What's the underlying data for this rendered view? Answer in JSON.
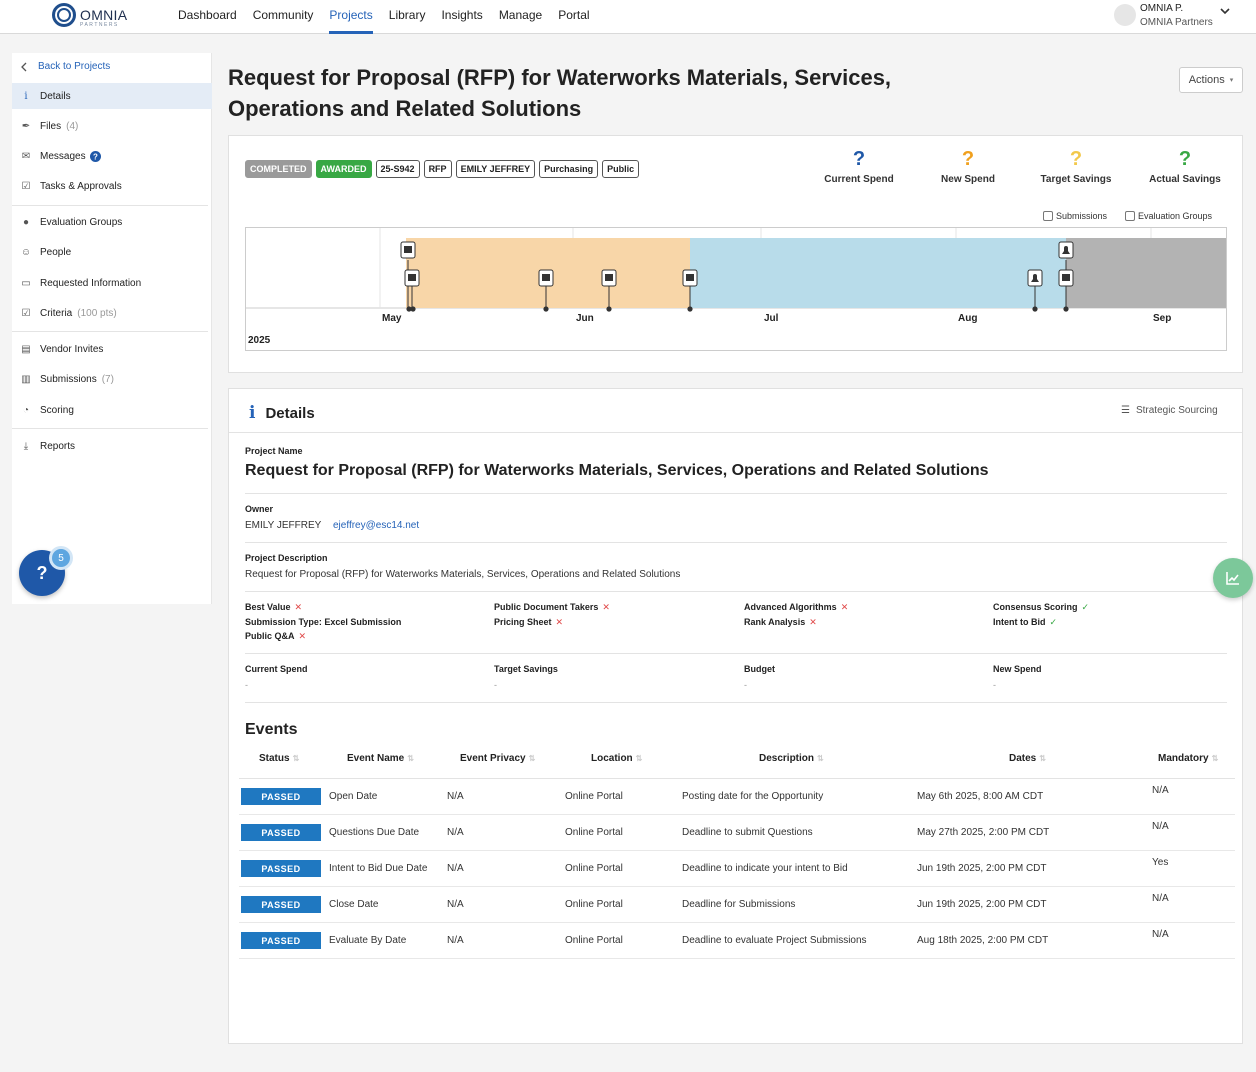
{
  "brand": {
    "name": "OMNIA",
    "sub": "PARTNERS"
  },
  "nav": [
    "Dashboard",
    "Community",
    "Projects",
    "Library",
    "Insights",
    "Manage",
    "Portal"
  ],
  "user": {
    "name": "OMNIA P.",
    "org": "OMNIA Partners"
  },
  "sidebar": {
    "back": "Back to Projects",
    "items": [
      {
        "label": "Details",
        "count": ""
      },
      {
        "label": "Files",
        "count": "(4)"
      },
      {
        "label": "Messages",
        "count": ""
      },
      {
        "label": "Tasks & Approvals",
        "count": ""
      },
      {
        "label": "Evaluation Groups",
        "count": ""
      },
      {
        "label": "People",
        "count": ""
      },
      {
        "label": "Requested Information",
        "count": ""
      },
      {
        "label": "Criteria",
        "count": "(100 pts)"
      },
      {
        "label": "Vendor Invites",
        "count": ""
      },
      {
        "label": "Submissions",
        "count": "(7)"
      },
      {
        "label": "Scoring",
        "count": ""
      },
      {
        "label": "Reports",
        "count": ""
      }
    ],
    "help_badge": "5",
    "help_glyph": "?"
  },
  "page": {
    "title": "Request for Proposal (RFP) for Waterworks Materials, Services, Operations and Related Solutions",
    "actions": "Actions"
  },
  "summary": {
    "tags": [
      "COMPLETED",
      "AWARDED",
      "25-S942",
      "RFP",
      "EMILY JEFFREY",
      "Purchasing",
      "Public"
    ],
    "kpis": [
      {
        "label": "Current Spend",
        "value": "?",
        "color": "#1f58a8"
      },
      {
        "label": "New Spend",
        "value": "?",
        "color": "#f0a01e"
      },
      {
        "label": "Target Savings",
        "value": "?",
        "color": "#f2c84a"
      },
      {
        "label": "Actual Savings",
        "value": "?",
        "color": "#38a844"
      }
    ],
    "checkboxes": [
      "Submissions",
      "Evaluation Groups"
    ]
  },
  "timeline": {
    "months": [
      "May",
      "Jun",
      "Jul",
      "Aug",
      "Sep"
    ],
    "year": "2025",
    "phase_colors": {
      "open": "#f8d6a8",
      "evaluation": "#b8dcea",
      "closed": "#b3b3b3"
    }
  },
  "details": {
    "heading": "Details",
    "strategic": "Strategic Sourcing",
    "project_name_label": "Project Name",
    "project_name": "Request for Proposal (RFP) for Waterworks Materials, Services, Operations and Related Solutions",
    "owner_label": "Owner",
    "owner_name": "EMILY JEFFREY",
    "owner_email": "ejeffrey@esc14.net",
    "desc_label": "Project Description",
    "desc": "Request for Proposal (RFP) for Waterworks Materials, Services, Operations and Related Solutions",
    "flags": [
      {
        "label": "Best Value",
        "on": false
      },
      {
        "label": "Submission Type: Excel Submission",
        "on": null
      },
      {
        "label": "Public Q&A",
        "on": false
      },
      {
        "label": "Public Document Takers",
        "on": false
      },
      {
        "label": "Pricing Sheet",
        "on": false
      },
      {
        "label": "Advanced Algorithms",
        "on": false
      },
      {
        "label": "Rank Analysis",
        "on": false
      },
      {
        "label": "Consensus Scoring",
        "on": true
      },
      {
        "label": "Intent to Bid",
        "on": true
      }
    ],
    "spend": [
      {
        "label": "Current Spend",
        "value": "-"
      },
      {
        "label": "Target Savings",
        "value": "-"
      },
      {
        "label": "Budget",
        "value": "-"
      },
      {
        "label": "New Spend",
        "value": "-"
      }
    ]
  },
  "events": {
    "title": "Events",
    "columns": [
      "Status",
      "Event Name",
      "Event Privacy",
      "Location",
      "Description",
      "Dates",
      "Mandatory"
    ],
    "rows": [
      {
        "status": "PASSED",
        "name": "Open Date",
        "privacy": "N/A",
        "location": "Online Portal",
        "desc": "Posting date for the Opportunity",
        "date": "May 6th 2025, 8:00 AM CDT",
        "mandatory": "N/A"
      },
      {
        "status": "PASSED",
        "name": "Questions Due Date",
        "privacy": "N/A",
        "location": "Online Portal",
        "desc": "Deadline to submit Questions",
        "date": "May 27th 2025, 2:00 PM CDT",
        "mandatory": "N/A"
      },
      {
        "status": "PASSED",
        "name": "Intent to Bid Due Date",
        "privacy": "N/A",
        "location": "Online Portal",
        "desc": "Deadline to indicate your intent to Bid",
        "date": "Jun 19th 2025, 2:00 PM CDT",
        "mandatory": "Yes"
      },
      {
        "status": "PASSED",
        "name": "Close Date",
        "privacy": "N/A",
        "location": "Online Portal",
        "desc": "Deadline for Submissions",
        "date": "Jun 19th 2025, 2:00 PM CDT",
        "mandatory": "N/A"
      },
      {
        "status": "PASSED",
        "name": "Evaluate By Date",
        "privacy": "N/A",
        "location": "Online Portal",
        "desc": "Deadline to evaluate Project Submissions",
        "date": "Aug 18th 2025, 2:00 PM CDT",
        "mandatory": "N/A"
      }
    ]
  }
}
